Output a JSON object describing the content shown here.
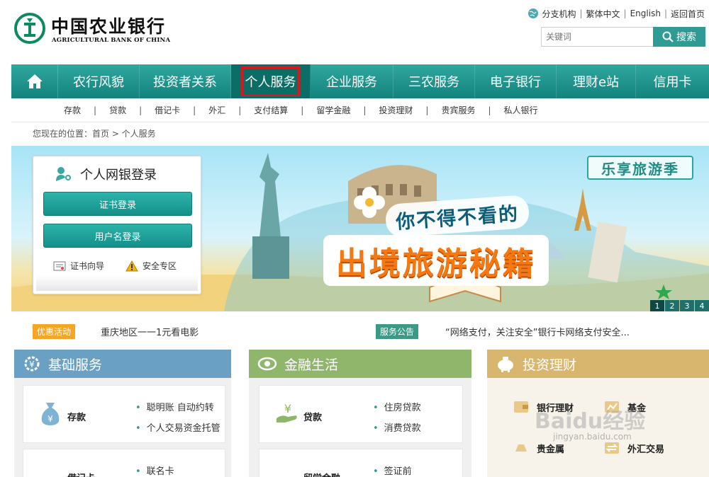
{
  "header": {
    "logo_cn": "中国农业银行",
    "logo_en": "AGRICULTURAL BANK OF CHINA",
    "links": [
      "分支机构",
      "繁体中文",
      "English",
      "返回首页"
    ],
    "search_placeholder": "关键词",
    "search_button": "搜索"
  },
  "nav": {
    "items": [
      "农行风貌",
      "投资者关系",
      "个人服务",
      "企业服务",
      "三农服务",
      "电子银行",
      "理财e站",
      "信用卡"
    ]
  },
  "subnav": {
    "items": [
      "存款",
      "贷款",
      "借记卡",
      "外汇",
      "支付结算",
      "留学金融",
      "投资理财",
      "贵宾服务",
      "私人银行"
    ]
  },
  "breadcrumb": "您现在的位置：首页 > 个人服务",
  "banner": {
    "tag": "乐享旅游季",
    "subtitle": "你不得不看的",
    "title": "出境旅游秘籍",
    "pages": [
      "1",
      "2",
      "3",
      "4"
    ]
  },
  "login": {
    "title": "个人网银登录",
    "cert_button": "证书登录",
    "user_button": "用户名登录",
    "link_cert_guide": "证书向导",
    "link_security": "安全专区"
  },
  "notice": {
    "badge1": "优惠活动",
    "text1": "重庆地区一一1元看电影",
    "badge2": "服务公告",
    "text2": "“网络支付，关注安全”银行卡网络支付安全..."
  },
  "panels": {
    "basic": {
      "title": "基础服务",
      "card1_label": "存款",
      "card1_links": [
        "聪明账 自动约转",
        "个人交易资金托管"
      ],
      "card2_label": "借记卡",
      "card2_links": [
        "联名卡"
      ]
    },
    "finance": {
      "title": "金融生活",
      "card1_label": "贷款",
      "card1_links": [
        "住房贷款",
        "消费贷款"
      ],
      "card2_label": "留学金融",
      "card2_links": [
        "签证前"
      ]
    },
    "invest": {
      "title": "投资理财",
      "items": [
        "银行理财",
        "基金",
        "贵金属",
        "外汇交易"
      ]
    }
  },
  "watermark": {
    "text": "Baidu经验",
    "url": "jingyan.baidu.com"
  },
  "colors": {
    "brand_teal": "#13827c",
    "active_outline": "#d9181e",
    "basic_panel": "#6aa0c4",
    "finance_panel": "#8fb66a",
    "invest_panel": "#d8b66e"
  }
}
